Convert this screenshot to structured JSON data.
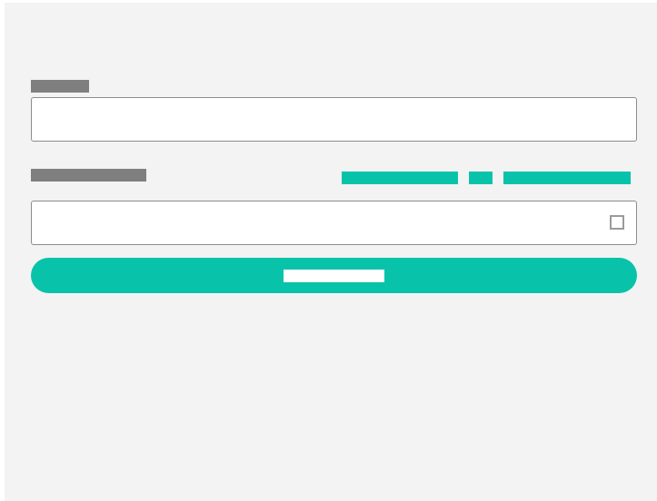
{
  "form": {
    "first_field": {
      "label": "",
      "value": "",
      "placeholder": ""
    },
    "second_field": {
      "label": "",
      "value": "",
      "placeholder": ""
    },
    "links": [
      {
        "label": ""
      },
      {
        "label": ""
      },
      {
        "label": ""
      }
    ],
    "submit": {
      "label": ""
    },
    "password_toggle": {
      "icon": "checkbox-square-icon",
      "checked": false
    }
  },
  "colors": {
    "panel_background": "#f3f3f3",
    "label_gray": "#7f7f7f",
    "accent": "#08c3aa",
    "input_border": "#8c8c8c",
    "input_background": "#ffffff",
    "toggle_border": "#9b9b9b"
  }
}
